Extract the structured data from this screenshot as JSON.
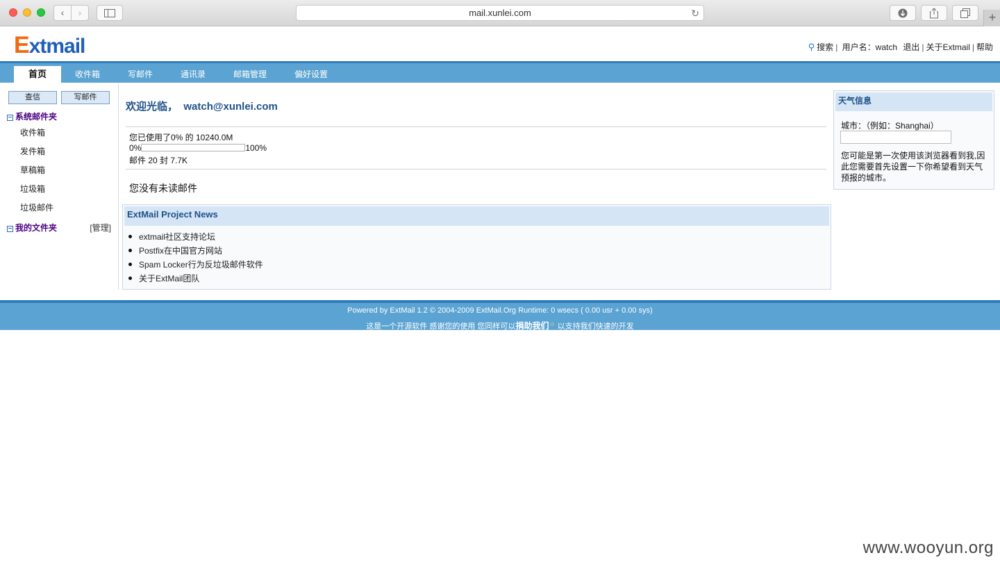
{
  "browser": {
    "url": "mail.xunlei.com",
    "reload_icon": "reload-icon",
    "back_icon": "chevron-left-icon",
    "forward_icon": "chevron-right-icon"
  },
  "header": {
    "logo_text_e": "E",
    "logo_text_rest": "xtmail",
    "search": "搜索",
    "username_label": "用户名：",
    "username": "watch",
    "logout": "退出",
    "about": "关于Extmail",
    "help": "帮助"
  },
  "nav": {
    "tabs": [
      {
        "label": "首页"
      },
      {
        "label": "收件箱"
      },
      {
        "label": "写邮件"
      },
      {
        "label": "通讯录"
      },
      {
        "label": "邮箱管理"
      },
      {
        "label": "偏好设置"
      }
    ]
  },
  "left": {
    "check_mail": "查信",
    "compose": "写邮件",
    "system_folders": "系统邮件夹",
    "folders": [
      {
        "label": "收件箱"
      },
      {
        "label": "发件箱"
      },
      {
        "label": "草稿箱"
      },
      {
        "label": "垃圾箱"
      },
      {
        "label": "垃圾邮件"
      }
    ],
    "my_folders": "我的文件夹",
    "manage": "[管理]"
  },
  "main": {
    "welcome_prefix": "欢迎光临，",
    "email": "watch@xunlei.com",
    "usage_text": "您已使用了0% 的 10240.0M",
    "quota_min": "0%",
    "quota_max": "100%",
    "quota_used_fraction": 0.0,
    "mail_count": "邮件 20 封 7.7K",
    "no_unread": "您没有未读邮件",
    "news_title": "ExtMail Project News",
    "news_items": [
      {
        "label": "extmail社区支持论坛"
      },
      {
        "label": "Postfix在中国官方网站"
      },
      {
        "label": "Spam Locker行为反垃圾邮件软件"
      },
      {
        "label": "关于ExtMail团队"
      }
    ]
  },
  "weather": {
    "title": "天气信息",
    "city_label": "城市：（例如：Shanghai）",
    "city_value": "",
    "message": "您可能是第一次使用该浏览器看到我,因此您需要首先设置一下你希望看到天气预报的城市。"
  },
  "footer": {
    "line1": "Powered by ExtMail 1.2 © 2004-2009 ExtMail.Org Runtime: 0 wsecs ( 0.00 usr + 0.00 sys)",
    "line2_prefix": "这是一个开源软件 感谢您的使用 您同样可以",
    "donate": "捐助我们",
    "line2_suffix": " 以支持我们快速的开发"
  },
  "watermark": "www.wooyun.org"
}
